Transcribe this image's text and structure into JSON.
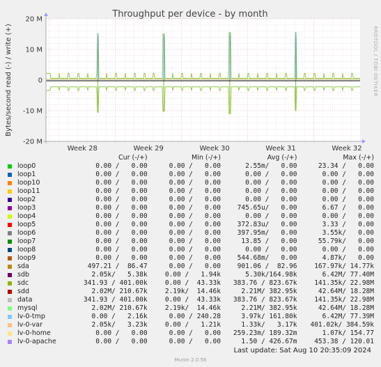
{
  "chart_data": {
    "type": "line",
    "title": "Throughput per device - by month",
    "ylabel": "Bytes/second read (-) / write (+)",
    "side_label": "RRDTOOL / TOBI OETIKER",
    "ylim": [
      -20000000,
      20000000
    ],
    "y_ticks": [
      {
        "value": 20000000,
        "label": "20 M"
      },
      {
        "value": 10000000,
        "label": "10 M"
      },
      {
        "value": 0,
        "label": "0"
      },
      {
        "value": -10000000,
        "label": "-10 M"
      },
      {
        "value": -20000000,
        "label": "-20 M"
      }
    ],
    "x_ticks": [
      "Week 28",
      "Week 29",
      "Week 30",
      "Week 31",
      "Week 32"
    ],
    "grid": true,
    "spikes_write_M": [
      15.2,
      15.1,
      15.5,
      15.6
    ],
    "spikes_read_M": [
      -10.5,
      -10.2,
      -11.0,
      -10.0
    ],
    "series": [
      {
        "name": "sdc",
        "color": "#94c94a"
      },
      {
        "name": "mysql",
        "color": "#74cfe8"
      },
      {
        "name": "sda",
        "color": "#a89a2c"
      }
    ]
  },
  "legend": {
    "headers": [
      "Cur (-/+)",
      "Min (-/+)",
      "Avg (-/+)",
      "Max (-/+)"
    ],
    "rows": [
      {
        "name": "loop0",
        "color": "#00cc00",
        "cur": "0.00 /   0.00",
        "min": "0.00 /   0.00",
        "avg": "2.55m/   0.00",
        "max": "23.34 /   0.00"
      },
      {
        "name": "loop1",
        "color": "#0066b3",
        "cur": "0.00 /   0.00",
        "min": "0.00 /   0.00",
        "avg": "0.00 /   0.00",
        "max": "0.00 /   0.00"
      },
      {
        "name": "loop10",
        "color": "#ff8000",
        "cur": "0.00 /   0.00",
        "min": "0.00 /   0.00",
        "avg": "0.00 /   0.00",
        "max": "0.00 /   0.00"
      },
      {
        "name": "loop11",
        "color": "#ffcc00",
        "cur": "0.00 /   0.00",
        "min": "0.00 /   0.00",
        "avg": "0.00 /   0.00",
        "max": "0.00 /   0.00"
      },
      {
        "name": "loop2",
        "color": "#330099",
        "cur": "0.00 /   0.00",
        "min": "0.00 /   0.00",
        "avg": "0.00 /   0.00",
        "max": "0.00 /   0.00"
      },
      {
        "name": "loop3",
        "color": "#990099",
        "cur": "0.00 /   0.00",
        "min": "0.00 /   0.00",
        "avg": "745.65u/   0.00",
        "max": "6.67 /   0.00"
      },
      {
        "name": "loop4",
        "color": "#ccff00",
        "cur": "0.00 /   0.00",
        "min": "0.00 /   0.00",
        "avg": "0.00 /   0.00",
        "max": "0.00 /   0.00"
      },
      {
        "name": "loop5",
        "color": "#ff0000",
        "cur": "0.00 /   0.00",
        "min": "0.00 /   0.00",
        "avg": "372.83u/   0.00",
        "max": "3.33 /   0.00"
      },
      {
        "name": "loop6",
        "color": "#808080",
        "cur": "0.00 /   0.00",
        "min": "0.00 /   0.00",
        "avg": "397.95m/   0.00",
        "max": "3.55k/   0.00"
      },
      {
        "name": "loop7",
        "color": "#008f00",
        "cur": "0.00 /   0.00",
        "min": "0.00 /   0.00",
        "avg": "13.85 /   0.00",
        "max": "55.79k/   0.00"
      },
      {
        "name": "loop8",
        "color": "#00487d",
        "cur": "0.00 /   0.00",
        "min": "0.00 /   0.00",
        "avg": "0.00 /   0.00",
        "max": "0.00 /   0.00"
      },
      {
        "name": "loop9",
        "color": "#b35a00",
        "cur": "0.00 /   0.00",
        "min": "0.00 /   0.00",
        "avg": "544.68m/   0.00",
        "max": "4.87k/   0.00"
      },
      {
        "name": "sda",
        "color": "#b38f00",
        "cur": "497.21 /  86.47",
        "min": "0.00 /   0.00",
        "avg": "901.06 /  82.96",
        "max": "167.97k/ 14.77k"
      },
      {
        "name": "sdb",
        "color": "#6b006b",
        "cur": "2.05k/   5.38k",
        "min": "0.00 /   1.94k",
        "avg": "5.30k/164.98k",
        "max": "6.42M/ 77.40M"
      },
      {
        "name": "sdc",
        "color": "#8fb300",
        "cur": "341.93 / 401.00k",
        "min": "0.00 /  43.33k",
        "avg": "383.76 / 823.67k",
        "max": "141.35k/ 22.98M"
      },
      {
        "name": "sdd",
        "color": "#b30000",
        "cur": "2.02M/ 210.67k",
        "min": "2.19k/  14.46k",
        "avg": "2.21M/ 382.95k",
        "max": "42.64M/ 18.28M"
      },
      {
        "name": "data",
        "color": "#bebebe",
        "cur": "341.93 / 401.00k",
        "min": "0.00 /  43.33k",
        "avg": "383.76 / 823.67k",
        "max": "141.35k/ 22.98M"
      },
      {
        "name": "mysql",
        "color": "#80ff80",
        "cur": "2.02M/ 210.67k",
        "min": "2.19k/  14.46k",
        "avg": "2.21M/ 382.95k",
        "max": "42.64M/ 18.28M"
      },
      {
        "name": "lv-0-tmp",
        "color": "#80c9ff",
        "cur": "0.00 /   2.16k",
        "min": "0.00 / 240.28",
        "avg": "3.97k/ 161.80k",
        "max": "6.42M/ 77.39M"
      },
      {
        "name": "lv-0-var",
        "color": "#ffc080",
        "cur": "2.05k/   3.23k",
        "min": "0.00 /   1.21k",
        "avg": "1.33k/   3.17k",
        "max": "401.02k/ 384.59k"
      },
      {
        "name": "lv-0-home",
        "color": "#ffe680",
        "cur": "0.00 /   0.00",
        "min": "0.00 /   0.00",
        "avg": "259.23m/ 189.32m",
        "max": "1.07k/ 154.77"
      },
      {
        "name": "lv-0-apache",
        "color": "#aa80ff",
        "cur": "0.00 /   0.00",
        "min": "0.00 /   0.00",
        "avg": "1.50 / 426.67m",
        "max": "453.38 / 120.01"
      }
    ]
  },
  "footer": {
    "last_update": "Last update: Sat Aug 10 20:35:09 2024",
    "generator": "Munin 2.0.56"
  }
}
